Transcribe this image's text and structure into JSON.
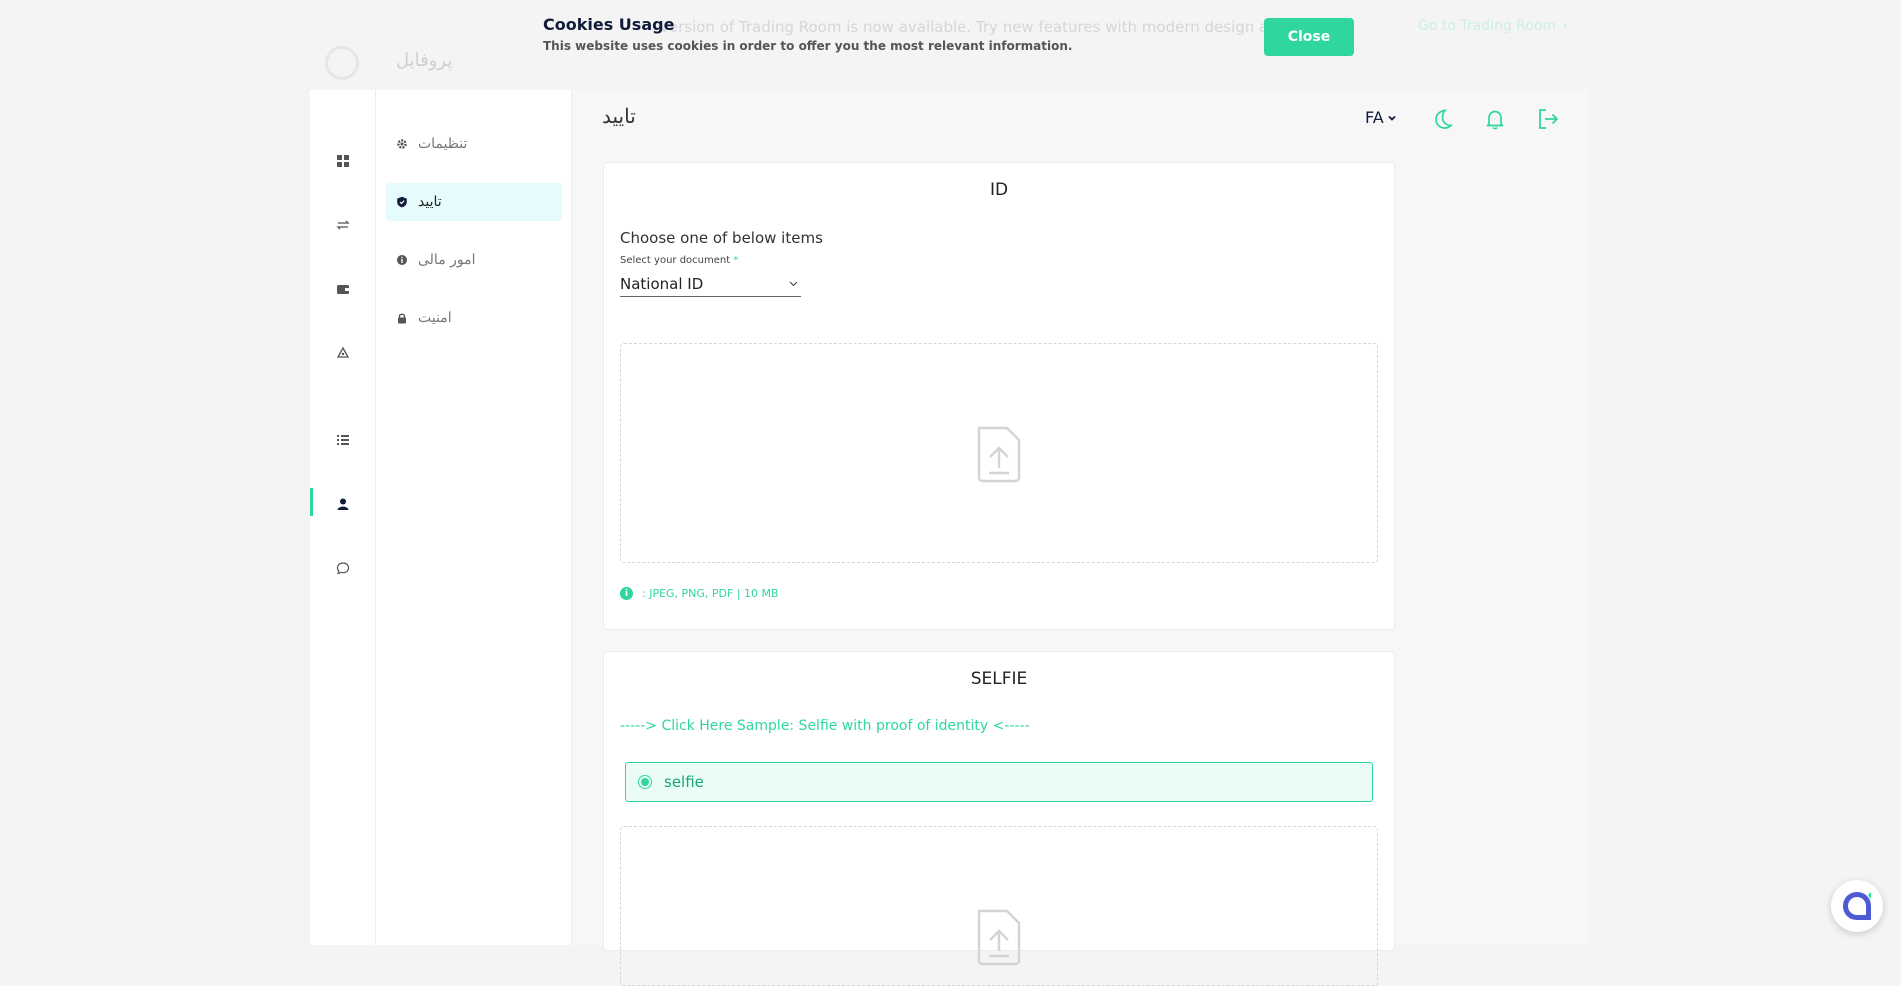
{
  "banner": {
    "text": "version of Trading Room is now available. Try new features with modern design and",
    "link": "Go to Trading Room"
  },
  "profile": {
    "title": "پروفایل"
  },
  "cookie": {
    "title": "Cookies Usage",
    "description": "This website uses cookies in order to offer you the most relevant information.",
    "close_label": "Close"
  },
  "rail": {
    "items": [
      "dashboard-icon",
      "exchange-icon",
      "wallet-icon",
      "recycle-icon",
      "list-icon",
      "user-icon",
      "chat-icon"
    ],
    "active": "user-icon"
  },
  "submenu": {
    "items": [
      {
        "label": "تنظیمات",
        "icon": "gear-icon"
      },
      {
        "label": "تایید",
        "icon": "shield-icon",
        "active": true
      },
      {
        "label": "امور مالی",
        "icon": "info-icon"
      },
      {
        "label": "امنیت",
        "icon": "lock-icon"
      }
    ]
  },
  "header": {
    "title": "تایید",
    "lang": "FA",
    "icons": [
      "moon-icon",
      "bell-icon",
      "logout-icon"
    ]
  },
  "id_card": {
    "title": "ID",
    "choose_text": "Choose one of below items",
    "select_label": "Select your document",
    "required_mark": "*",
    "select_value": "National ID",
    "formats": ": JPEG, PNG, PDF | 10 MB"
  },
  "selfie_card": {
    "title": "SELFIE",
    "sample_link": "-----> Click Here Sample: Selfie with proof of identity <-----",
    "option_label": "selfie"
  },
  "colors": {
    "accent": "#2fd6a0",
    "navy": "#111b3a",
    "background": "#f4f4f4"
  }
}
